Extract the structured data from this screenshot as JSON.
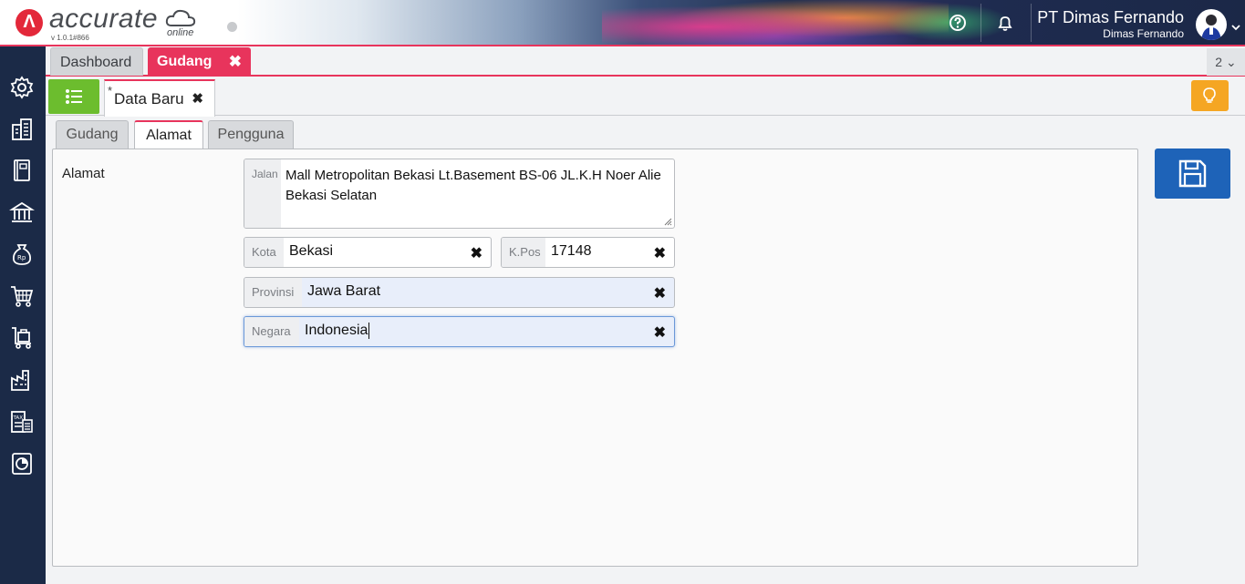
{
  "header": {
    "logo_text": "accurate",
    "logo_sub": "online",
    "version": "v 1.0.1#866",
    "company": "PT Dimas Fernando",
    "user": "Dimas Fernando",
    "accent_color": "#e8345c"
  },
  "sidebar": {
    "items": [
      {
        "icon": "gear-icon"
      },
      {
        "icon": "building-icon"
      },
      {
        "icon": "book-icon"
      },
      {
        "icon": "bank-icon"
      },
      {
        "icon": "money-bag-icon"
      },
      {
        "icon": "cart-icon"
      },
      {
        "icon": "shopping-bag-icon"
      },
      {
        "icon": "factory-icon"
      },
      {
        "icon": "tax-icon"
      },
      {
        "icon": "report-icon"
      }
    ]
  },
  "module_tabs": {
    "dashboard": "Dashboard",
    "gudang": "Gudang",
    "count": "2"
  },
  "doc_tabs": {
    "star": "*",
    "data_baru": "Data Baru"
  },
  "form_tabs": {
    "gudang": "Gudang",
    "alamat": "Alamat",
    "pengguna": "Pengguna"
  },
  "form": {
    "section_label": "Alamat",
    "jalan": {
      "prefix": "Jalan",
      "value": "Mall Metropolitan Bekasi Lt.Basement  BS-06 JL.K.H Noer Alie Bekasi Selatan"
    },
    "kota": {
      "prefix": "Kota",
      "value": "Bekasi"
    },
    "kpos": {
      "prefix": "K.Pos",
      "value": "17148"
    },
    "provinsi": {
      "prefix": "Provinsi",
      "value": "Jawa Barat"
    },
    "negara": {
      "prefix": "Negara",
      "value": "Indonesia"
    }
  }
}
